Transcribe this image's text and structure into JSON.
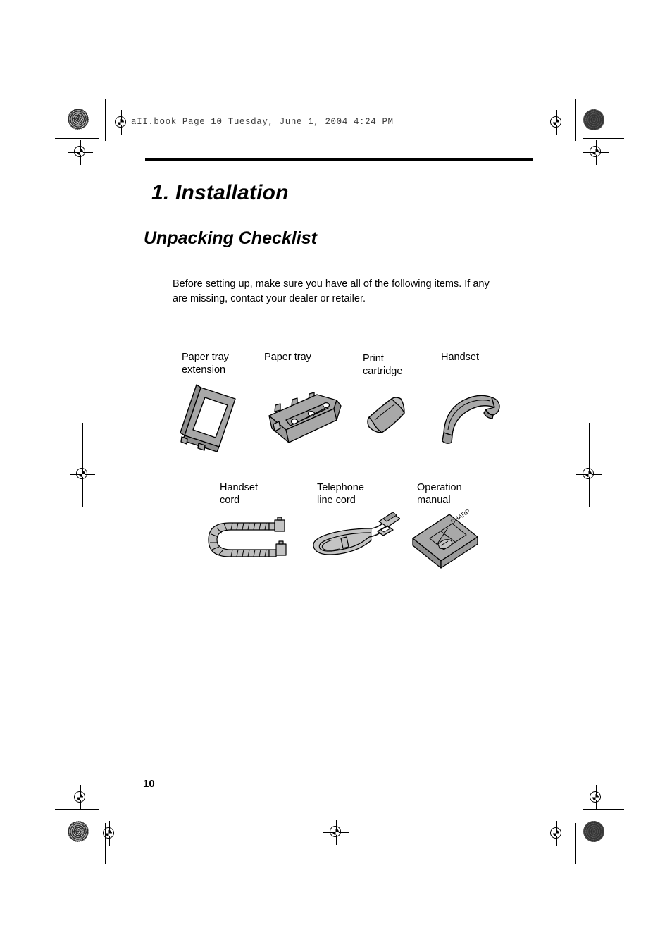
{
  "page": {
    "header_line": "aII.book  Page 10  Tuesday, June 1, 2004  4:24 PM",
    "chapter_title": "1.  Installation",
    "section_title": "Unpacking Checklist",
    "intro_paragraph": "Before setting up, make sure you have all of the following items. If any are missing, contact your dealer or retailer.",
    "page_number": "10"
  },
  "colors": {
    "ink": "#000000",
    "art_fill": "#a8a8a8",
    "art_fill_light": "#c4c4c4",
    "art_fill_dark": "#8e8e8e",
    "paper": "#ffffff"
  },
  "checklist": {
    "row1": [
      {
        "label": "Paper tray\nextension",
        "art": "paper-tray-extension"
      },
      {
        "label": "Paper tray",
        "art": "paper-tray"
      },
      {
        "label": "Print\ncartridge",
        "art": "print-cartridge"
      },
      {
        "label": "Handset",
        "art": "handset"
      }
    ],
    "row2": [
      {
        "label": "Handset\ncord",
        "art": "handset-cord"
      },
      {
        "label": "Telephone\nline cord",
        "art": "telephone-line-cord"
      },
      {
        "label": "Operation\nmanual",
        "art": "operation-manual"
      }
    ]
  },
  "artwork": {
    "manual_cover_brand": "SHARP"
  }
}
